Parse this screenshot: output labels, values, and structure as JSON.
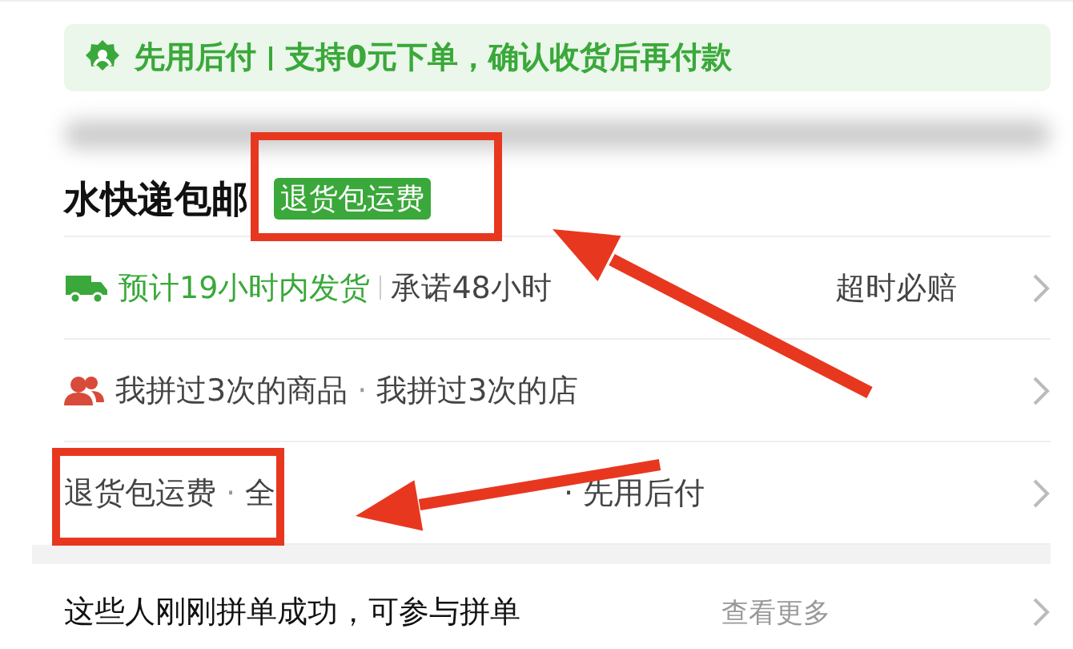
{
  "banner": {
    "title": "先用后付",
    "text": "支持0元下单，确认收货后再付款"
  },
  "shipping": {
    "text": "水快递包邮",
    "tag": "退货包运费"
  },
  "rows": [
    {
      "kind": "truck",
      "highlight": "预计19小时内发货",
      "items": [
        "承诺48小时"
      ],
      "tail": [
        "超时必赔"
      ]
    },
    {
      "kind": "people",
      "separator": "·",
      "items": [
        "我拼过3次的商品",
        "我拼过3次的店"
      ]
    },
    {
      "kind": "plain",
      "separator": "·",
      "items": [
        "退货包运费",
        "全"
      ],
      "tail": [
        "·",
        "先用后付"
      ]
    }
  ],
  "group_section": {
    "title": "这些人刚刚拼单成功，可参与拼单",
    "more": "查看更多"
  }
}
